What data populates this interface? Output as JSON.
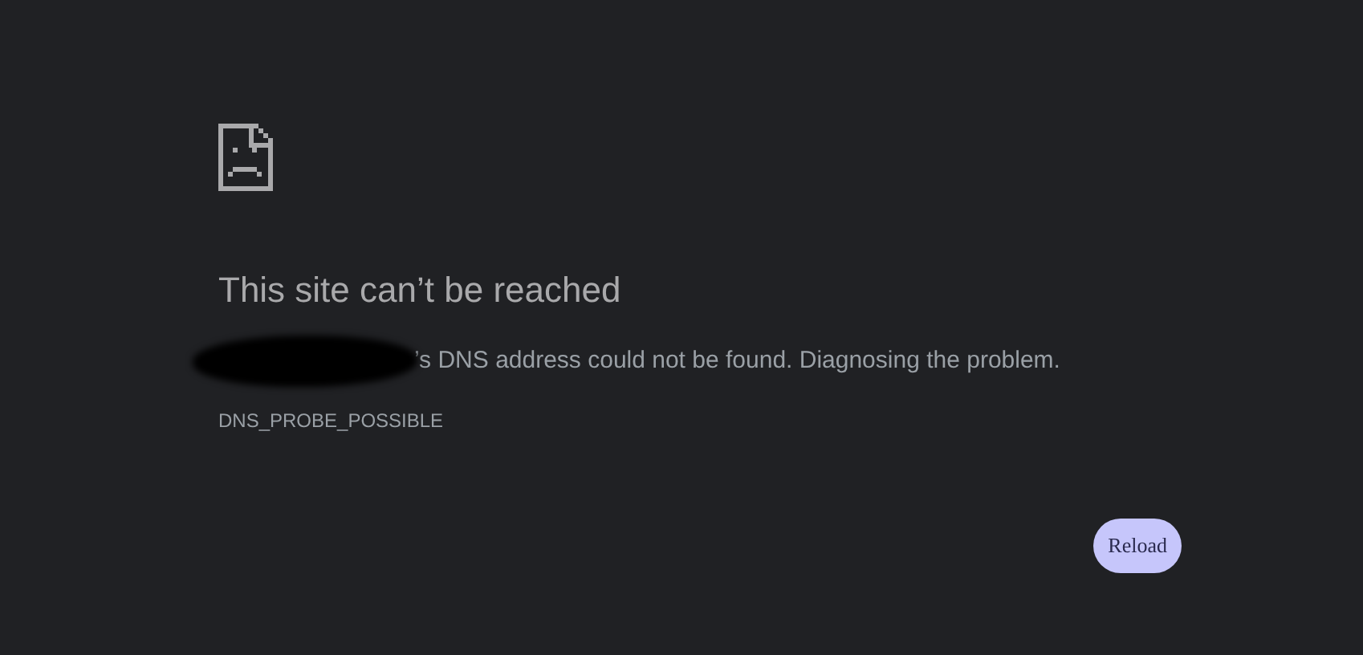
{
  "title": "This site can’t be reached",
  "message": "’s DNS address could not be found. Diagnosing the problem.",
  "error_code": "DNS_PROBE_POSSIBLE",
  "buttons": [
    "Reload"
  ]
}
